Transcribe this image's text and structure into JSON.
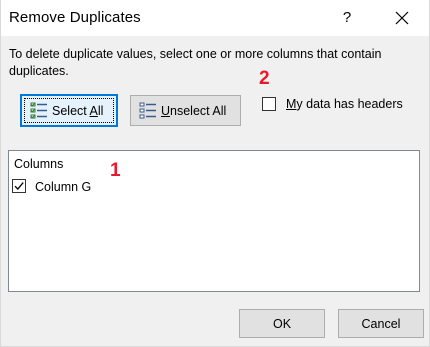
{
  "window": {
    "title": "Remove Duplicates",
    "help_label": "?"
  },
  "instructions": "To delete duplicate values, select one or more columns that contain duplicates.",
  "buttons": {
    "select_all": {
      "prefix": "Select ",
      "mnemonic": "A",
      "suffix": "ll"
    },
    "unselect_all": {
      "prefix": "",
      "mnemonic": "U",
      "suffix": "nselect All"
    },
    "ok": "OK",
    "cancel": "Cancel"
  },
  "headers_option": {
    "prefix": "",
    "mnemonic": "M",
    "suffix": "y data has headers",
    "checked": false
  },
  "columns": {
    "header": "Columns",
    "items": [
      {
        "label": "Column G",
        "checked": true
      }
    ]
  },
  "annotations": {
    "one": "1",
    "two": "2"
  },
  "colors": {
    "annotation": "#e8192c",
    "focus_border": "#0078d7",
    "dialog_bg": "#f0f0f0"
  },
  "icons": {
    "select_all": "select-all-list-icon",
    "unselect_all": "unselect-all-list-icon",
    "close": "close-icon",
    "checkmark": "checkmark-icon"
  }
}
